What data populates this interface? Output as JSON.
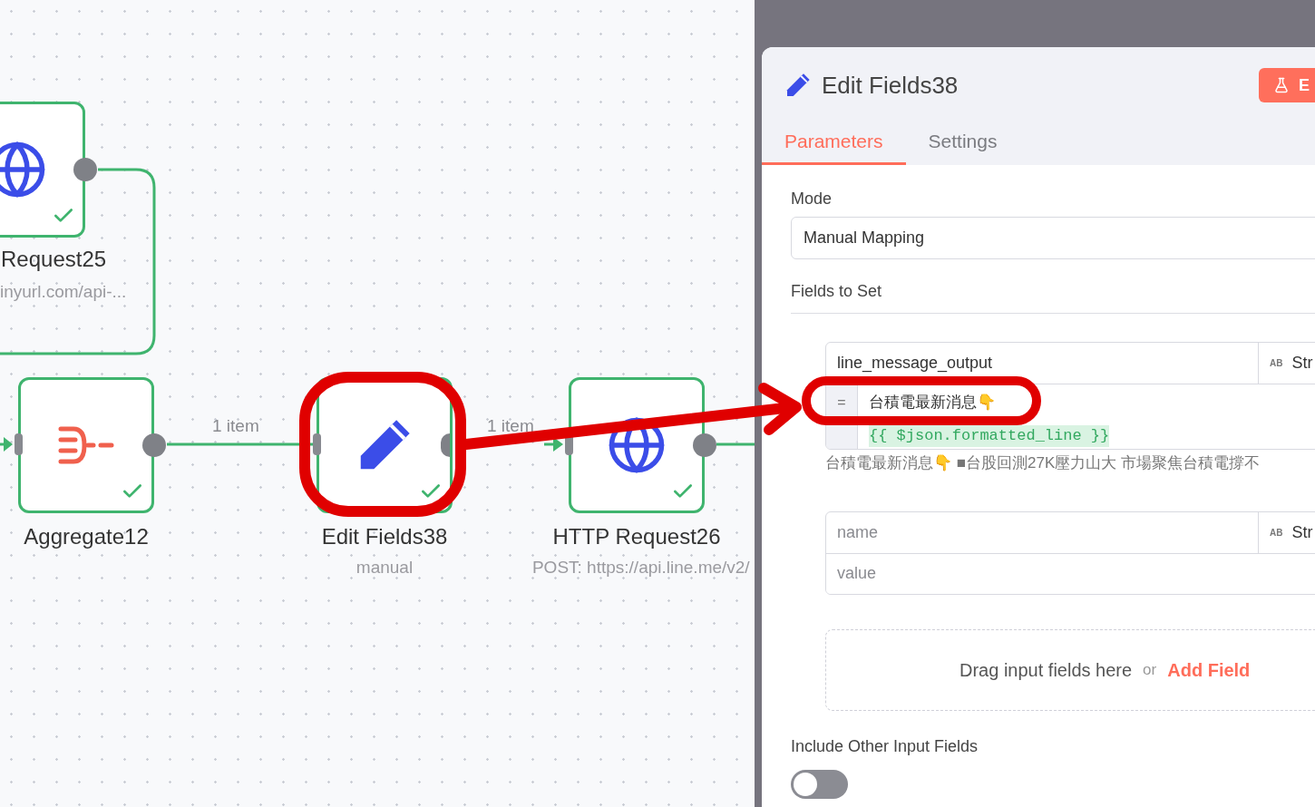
{
  "canvas": {
    "nodes": [
      {
        "kind": "http",
        "title": "Request25",
        "subtitle": "inyurl.com/api-...",
        "success": true
      },
      {
        "kind": "aggregate",
        "title": "Aggregate12",
        "success": true
      },
      {
        "kind": "edit",
        "title": "Edit Fields38",
        "subtitle": "manual",
        "success": true
      },
      {
        "kind": "http",
        "title": "HTTP Request26",
        "subtitle": "POST: https://api.line.me/v2/",
        "success": true
      }
    ],
    "edge_labels": [
      "1 item",
      "1 item"
    ]
  },
  "annotations": [
    {
      "kind": "circle"
    },
    {
      "kind": "arrow"
    },
    {
      "kind": "ellipse"
    }
  ],
  "panel": {
    "title": "Edit Fields38",
    "test_button": "E",
    "tabs": [
      {
        "label": "Parameters",
        "selected": true
      },
      {
        "label": "Settings",
        "selected": false
      }
    ],
    "mode": {
      "label": "Mode",
      "value": "Manual Mapping"
    },
    "fields_section": "Fields to Set",
    "fields": [
      {
        "name": "line_message_output",
        "type_badge": "AB",
        "type": "Str",
        "gutter": "=",
        "value_lines": [
          "台積電最新消息👇",
          "{{ $json.formatted_line }}"
        ],
        "preview": "台積電最新消息👇 ■台股回測27K壓力山大 市場聚焦台積電撐不"
      },
      {
        "name_placeholder": "name",
        "type_badge": "AB",
        "type": "Str",
        "value_placeholder": "value"
      }
    ],
    "drop_zone": {
      "text": "Drag input fields here",
      "or": "or",
      "link": "Add Field"
    },
    "include_other": {
      "label": "Include Other Input Fields",
      "on": false
    }
  }
}
